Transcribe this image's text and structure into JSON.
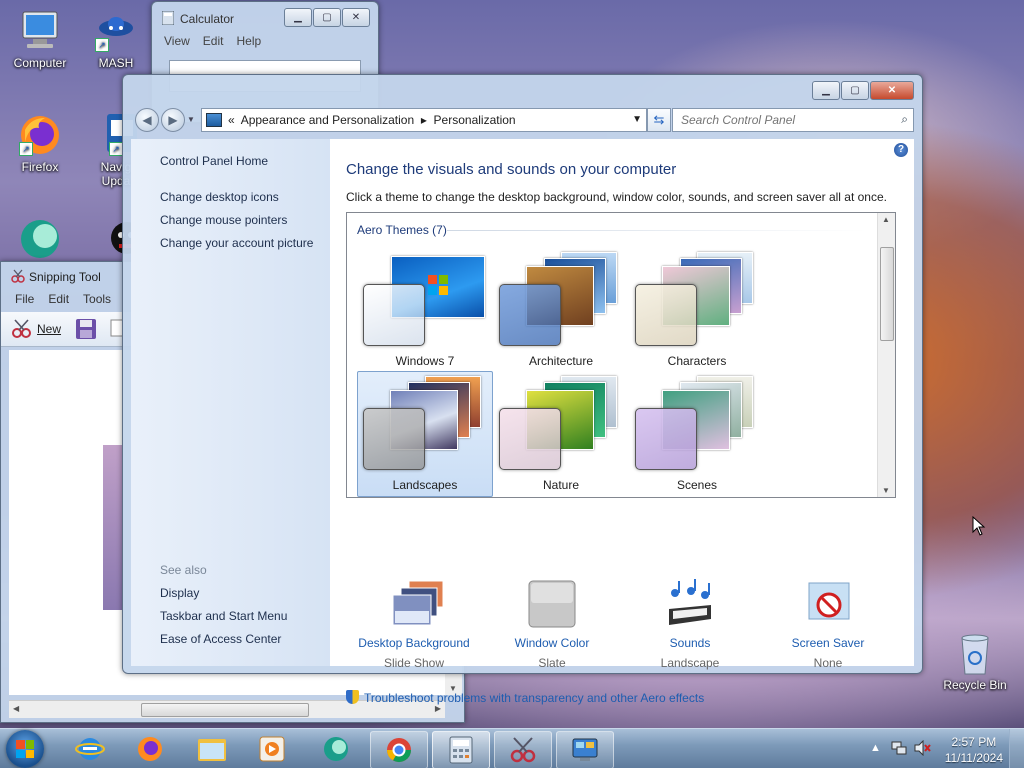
{
  "desktop": {
    "icons": [
      {
        "label": "Computer"
      },
      {
        "label": "MASH"
      },
      {
        "label": "Firefox"
      },
      {
        "label": "Navig",
        "label2": "Upda"
      },
      {
        "label": "Recycle Bin"
      }
    ]
  },
  "calculator": {
    "title": "Calculator",
    "menu": [
      "View",
      "Edit",
      "Help"
    ]
  },
  "snipping": {
    "title": "Snipping Tool",
    "menu": [
      "File",
      "Edit",
      "Tools"
    ],
    "new_label": "New"
  },
  "control_panel": {
    "breadcrumb": [
      "«",
      "Appearance and Personalization",
      "▸",
      "Personalization"
    ],
    "search_placeholder": "Search Control Panel",
    "sidebar": {
      "home": "Control Panel Home",
      "links": [
        "Change desktop icons",
        "Change mouse pointers",
        "Change your account picture"
      ],
      "see_also_label": "See also",
      "see_also": [
        "Display",
        "Taskbar and Start Menu",
        "Ease of Access Center"
      ]
    },
    "heading": "Change the visuals and sounds on your computer",
    "description": "Click a theme to change the desktop background, window color, sounds, and screen saver all at once.",
    "theme_group": "Aero Themes (7)",
    "themes": [
      {
        "name": "Windows 7",
        "selected": false
      },
      {
        "name": "Architecture",
        "selected": false
      },
      {
        "name": "Characters",
        "selected": false
      },
      {
        "name": "Landscapes",
        "selected": true
      },
      {
        "name": "Nature",
        "selected": false
      },
      {
        "name": "Scenes",
        "selected": false
      }
    ],
    "options": [
      {
        "label": "Desktop Background",
        "value": "Slide Show"
      },
      {
        "label": "Window Color",
        "value": "Slate"
      },
      {
        "label": "Sounds",
        "value": "Landscape"
      },
      {
        "label": "Screen Saver",
        "value": "None"
      }
    ],
    "troubleshoot": "Troubleshoot problems with transparency and other Aero effects"
  },
  "taskbar": {
    "time": "2:57 PM",
    "date": "11/11/2024"
  }
}
